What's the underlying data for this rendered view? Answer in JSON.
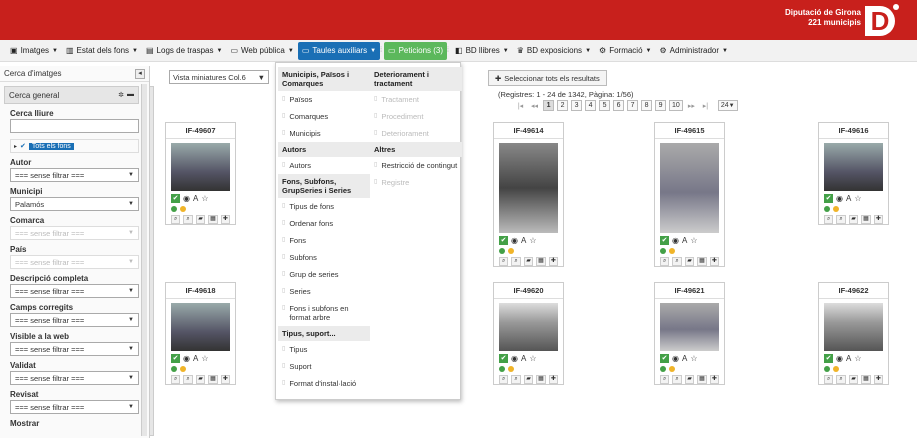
{
  "brand": {
    "line1": "Diputació de Girona",
    "line2": "221 municipis",
    "logo": "D"
  },
  "menu": [
    {
      "label": "Imatges",
      "icon": "image-icon"
    },
    {
      "label": "Estat dels fons",
      "icon": "bar-chart-icon"
    },
    {
      "label": "Logs de traspas",
      "icon": "document-icon"
    },
    {
      "label": "Web pública",
      "icon": "monitor-icon"
    },
    {
      "label": "Taules auxiliars",
      "icon": "monitor-icon"
    },
    {
      "label": "Peticions (3)",
      "icon": "monitor-icon"
    },
    {
      "label": "BD llibres",
      "icon": "book-icon"
    },
    {
      "label": "BD exposicions",
      "icon": "trophy-icon"
    },
    {
      "label": "Formació",
      "icon": "gear-icon"
    },
    {
      "label": "Administrador",
      "icon": "gears-icon"
    }
  ],
  "sidebar": {
    "title": "Cerca d'imatges",
    "section": "Cerca general",
    "free_label": "Cerca lliure",
    "tree_tag": "Tots els fons",
    "filters": [
      {
        "label": "Autor",
        "value": "=== sense filtrar ===",
        "disabled": false
      },
      {
        "label": "Municipi",
        "value": "Palamós",
        "disabled": false
      },
      {
        "label": "Comarca",
        "value": "=== sense filtrar ===",
        "disabled": true
      },
      {
        "label": "País",
        "value": "=== sense filtrar ===",
        "disabled": true
      },
      {
        "label": "Descripció completa",
        "value": "=== sense filtrar ===",
        "disabled": false
      },
      {
        "label": "Camps corregits",
        "value": "=== sense filtrar ===",
        "disabled": false
      },
      {
        "label": "Visible a la web",
        "value": "=== sense filtrar ===",
        "disabled": false
      },
      {
        "label": "Validat",
        "value": "=== sense filtrar ===",
        "disabled": false
      },
      {
        "label": "Revisat",
        "value": "=== sense filtrar ===",
        "disabled": false
      },
      {
        "label": "Mostrar",
        "value": "",
        "disabled": false
      }
    ]
  },
  "main": {
    "view_select": "Vista miniatures Col.6",
    "select_all": "Seleccionar tots els resultats",
    "records": "(Registres: 1 - 24 de 1342, Pàgina: 1/56)",
    "pages": [
      "1",
      "2",
      "3",
      "4",
      "5",
      "6",
      "7",
      "8",
      "9",
      "10"
    ],
    "page_size": "24",
    "cards": [
      "IF-49607",
      "IF-49614",
      "IF-49615",
      "IF-49616",
      "IF-49618",
      "IF-49620",
      "IF-49621",
      "IF-49622"
    ]
  },
  "dropdown": {
    "col1": [
      {
        "type": "head",
        "label": "Municipis, Països i Comarques"
      },
      {
        "type": "item",
        "label": "Països"
      },
      {
        "type": "item",
        "label": "Comarques"
      },
      {
        "type": "item",
        "label": "Municipis"
      },
      {
        "type": "head",
        "label": "Autors"
      },
      {
        "type": "item",
        "label": "Autors"
      },
      {
        "type": "head",
        "label": "Fons, Subfons, GrupSeries i Series"
      },
      {
        "type": "item",
        "label": "Tipus de fons"
      },
      {
        "type": "item",
        "label": "Ordenar fons"
      },
      {
        "type": "item",
        "label": "Fons"
      },
      {
        "type": "item",
        "label": "Subfons"
      },
      {
        "type": "item",
        "label": "Grup de series"
      },
      {
        "type": "item",
        "label": "Series"
      },
      {
        "type": "item",
        "label": "Fons i subfons en format arbre"
      },
      {
        "type": "head",
        "label": "Tipus, suport..."
      },
      {
        "type": "item",
        "label": "Tipus"
      },
      {
        "type": "item",
        "label": "Suport"
      },
      {
        "type": "item",
        "label": "Format d'instal·lació"
      }
    ],
    "col2": [
      {
        "type": "head",
        "label": "Deteriorament i tractament"
      },
      {
        "type": "item",
        "label": "Tractament",
        "disabled": true
      },
      {
        "type": "item",
        "label": "Procediment",
        "disabled": true
      },
      {
        "type": "item",
        "label": "Deteriorament",
        "disabled": true
      },
      {
        "type": "head",
        "label": "Altres"
      },
      {
        "type": "item",
        "label": "Restricció de contingut"
      },
      {
        "type": "item",
        "label": "Registre",
        "disabled": true
      }
    ]
  }
}
